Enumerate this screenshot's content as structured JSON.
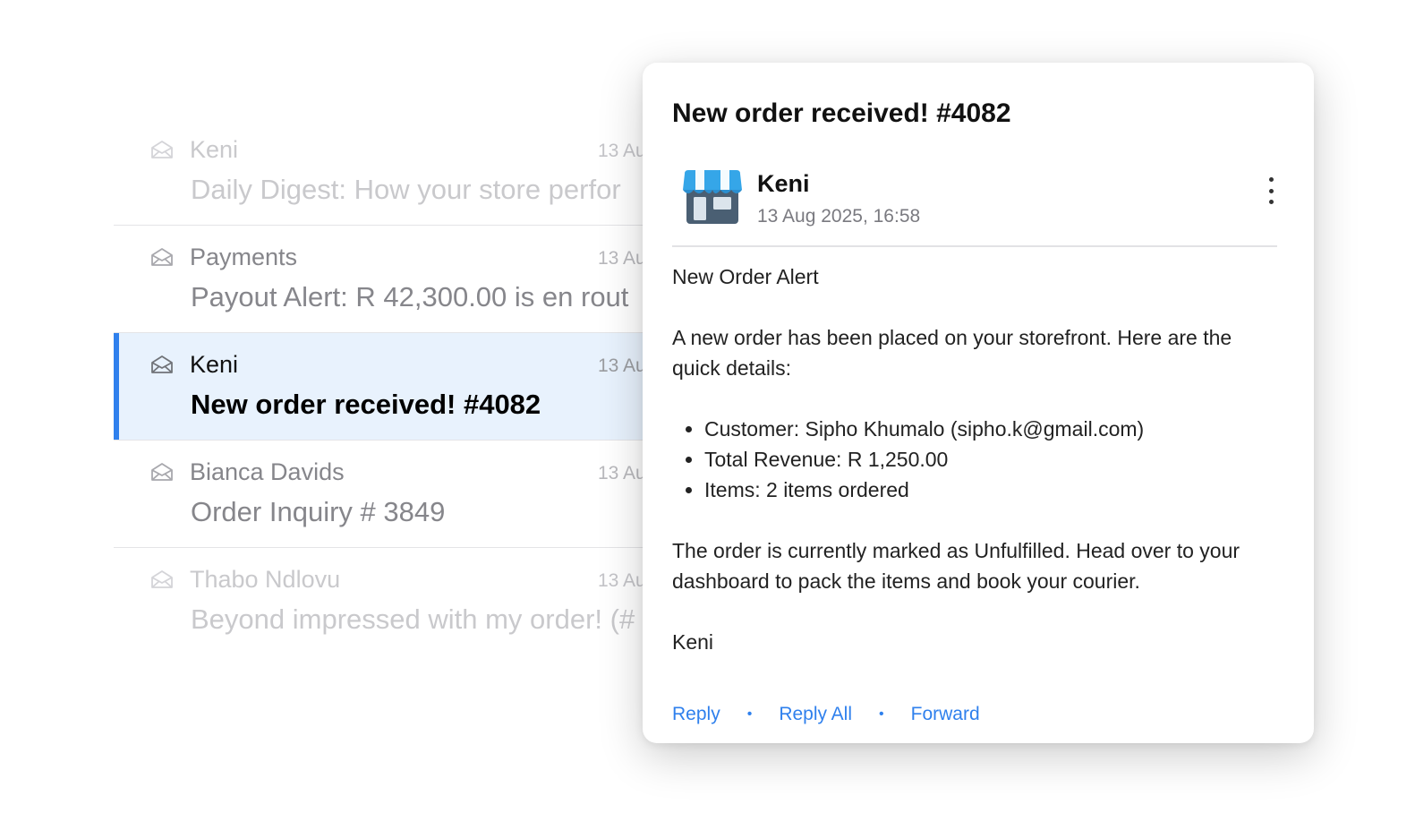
{
  "inbox": {
    "rows": [
      {
        "sender": "Keni",
        "date": "13 Au",
        "subject": "Daily Digest: How your store perfor"
      },
      {
        "sender": "Payments",
        "date": "13 Au",
        "subject": "Payout Alert: R 42,300.00 is en rout"
      },
      {
        "sender": "Keni",
        "date": "13 Au",
        "subject": "New order received! #4082"
      },
      {
        "sender": "Bianca Davids",
        "date": "13 Au",
        "subject": "Order Inquiry # 3849"
      },
      {
        "sender": "Thabo Ndlovu",
        "date": "13 Au",
        "subject": "Beyond impressed with my order! (#"
      }
    ],
    "selected_index": 2,
    "icon": "open-envelope-icon"
  },
  "email": {
    "title": "New order received! #4082",
    "from_name": "Keni",
    "from_date": "13 Aug 2025, 16:58",
    "avatar_icon": "storefront-icon",
    "menu_icon": "more-vertical-icon",
    "greeting": "New Order Alert",
    "intro": "A new order has been placed on your storefront. Here are the quick details:",
    "details": [
      "Customer: Sipho Khumalo (sipho.k@gmail.com)",
      "Total Revenue: R 1,250.00",
      "Items: 2 items ordered"
    ],
    "outro": "The order is currently marked as Unfulfilled. Head over to your dashboard to pack the items and book your courier.",
    "signature": "Keni",
    "actions": {
      "reply": "Reply",
      "reply_all": "Reply All",
      "forward": "Forward",
      "separator": "•"
    }
  },
  "colors": {
    "accent": "#2f80ed",
    "selected_row_bg": "#e8f2fd",
    "logo_awning_blue": "#35a6e8",
    "logo_body": "#4a5f73"
  }
}
